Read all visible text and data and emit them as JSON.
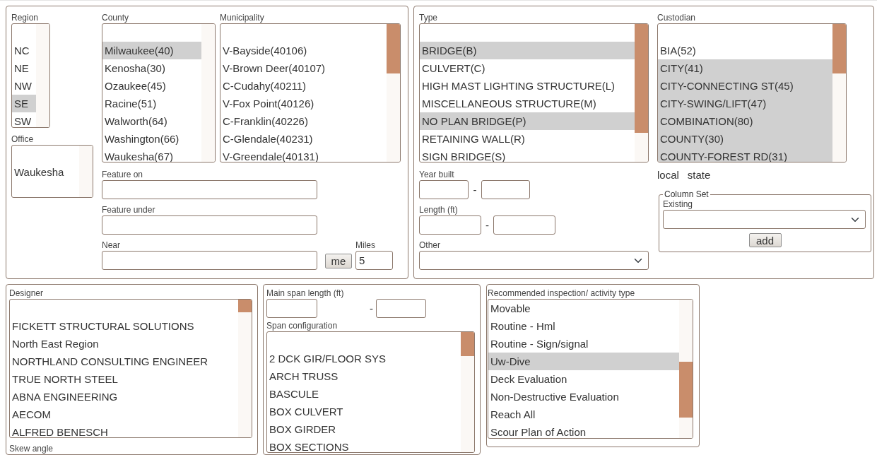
{
  "location_panel": {
    "region": {
      "label": "Region",
      "items": [
        {
          "label": "NC",
          "selected": false
        },
        {
          "label": "NE",
          "selected": false
        },
        {
          "label": "NW",
          "selected": false
        },
        {
          "label": "SE",
          "selected": true
        },
        {
          "label": "SW",
          "selected": false
        }
      ]
    },
    "office": {
      "label": "Office",
      "items": [
        {
          "label": "Waukesha",
          "selected": false
        }
      ]
    },
    "county": {
      "label": "County",
      "items": [
        {
          "label": "Milwaukee(40)",
          "selected": true
        },
        {
          "label": "Kenosha(30)",
          "selected": false
        },
        {
          "label": "Ozaukee(45)",
          "selected": false
        },
        {
          "label": "Racine(51)",
          "selected": false
        },
        {
          "label": "Walworth(64)",
          "selected": false
        },
        {
          "label": "Washington(66)",
          "selected": false
        },
        {
          "label": "Waukesha(67)",
          "selected": false
        }
      ]
    },
    "municipality": {
      "label": "Municipality",
      "items": [
        {
          "label": "V-Bayside(40106)",
          "selected": false
        },
        {
          "label": "V-Brown Deer(40107)",
          "selected": false
        },
        {
          "label": "C-Cudahy(40211)",
          "selected": false
        },
        {
          "label": "V-Fox Point(40126)",
          "selected": false
        },
        {
          "label": "C-Franklin(40226)",
          "selected": false
        },
        {
          "label": "C-Glendale(40231)",
          "selected": false
        },
        {
          "label": "V-Greendale(40131)",
          "selected": false
        }
      ]
    },
    "feature_on": {
      "label": "Feature on"
    },
    "feature_under": {
      "label": "Feature under"
    },
    "near": {
      "label": "Near",
      "button": "me"
    },
    "miles": {
      "label": "Miles",
      "value": "5"
    }
  },
  "structure_panel": {
    "type": {
      "label": "Type",
      "items": [
        {
          "label": "BRIDGE(B)",
          "selected": true
        },
        {
          "label": "CULVERT(C)",
          "selected": false
        },
        {
          "label": "HIGH MAST LIGHTING STRUCTURE(L)",
          "selected": false
        },
        {
          "label": "MISCELLANEOUS STRUCTURE(M)",
          "selected": false
        },
        {
          "label": "NO PLAN BRIDGE(P)",
          "selected": true
        },
        {
          "label": "RETAINING WALL(R)",
          "selected": false
        },
        {
          "label": "SIGN BRIDGE(S)",
          "selected": false
        }
      ]
    },
    "year_built": {
      "label": "Year built",
      "separator": "-"
    },
    "length": {
      "label": "Length (ft)",
      "separator": "-"
    },
    "other": {
      "label": "Other"
    },
    "custodian": {
      "label": "Custodian",
      "items": [
        {
          "label": "BIA(52)",
          "selected": false
        },
        {
          "label": "CITY(41)",
          "selected": true
        },
        {
          "label": "CITY-CONNECTING ST(45)",
          "selected": true
        },
        {
          "label": "CITY-SWING/LIFT(47)",
          "selected": true
        },
        {
          "label": "COMBINATION(80)",
          "selected": true
        },
        {
          "label": "COUNTY(30)",
          "selected": true
        },
        {
          "label": "COUNTY-FOREST RD(31)",
          "selected": true
        }
      ]
    },
    "scope_options": [
      "local",
      "state"
    ],
    "column_set": {
      "legend": "Column Set",
      "existing_label": "Existing",
      "button": "add"
    }
  },
  "designer_panel": {
    "designer": {
      "label": "Designer",
      "items": [
        {
          "label": "FICKETT STRUCTURAL SOLUTIONS",
          "selected": false
        },
        {
          "label": "North East Region",
          "selected": false
        },
        {
          "label": "NORTHLAND CONSULTING ENGINEER",
          "selected": false
        },
        {
          "label": "TRUE NORTH STEEL",
          "selected": false
        },
        {
          "label": "ABNA ENGINEERING",
          "selected": false
        },
        {
          "label": "AECOM",
          "selected": false
        },
        {
          "label": "ALFRED BENESCH",
          "selected": false
        }
      ]
    },
    "skew_angle_label": "Skew angle"
  },
  "span_panel": {
    "main_span": {
      "label": "Main span length (ft)",
      "separator": "-"
    },
    "span_configuration": {
      "label": "Span configuration",
      "items": [
        {
          "label": "2 DCK GIR/FLOOR SYS",
          "selected": false
        },
        {
          "label": "ARCH TRUSS",
          "selected": false
        },
        {
          "label": "BASCULE",
          "selected": false
        },
        {
          "label": "BOX CULVERT",
          "selected": false
        },
        {
          "label": "BOX GIRDER",
          "selected": false
        },
        {
          "label": "BOX SECTIONS",
          "selected": false
        }
      ]
    }
  },
  "inspection_panel": {
    "recommended": {
      "label": "Recommended inspection/ activity type",
      "items": [
        {
          "label": "Movable",
          "selected": false
        },
        {
          "label": "Routine - Hml",
          "selected": false
        },
        {
          "label": "Routine - Sign/signal",
          "selected": false
        },
        {
          "label": "Uw-Dive",
          "selected": true
        },
        {
          "label": "Deck Evaluation",
          "selected": false
        },
        {
          "label": "Non-Destructive Evaluation",
          "selected": false
        },
        {
          "label": "Reach All",
          "selected": false
        },
        {
          "label": "Scour Plan of Action",
          "selected": false
        }
      ]
    }
  }
}
